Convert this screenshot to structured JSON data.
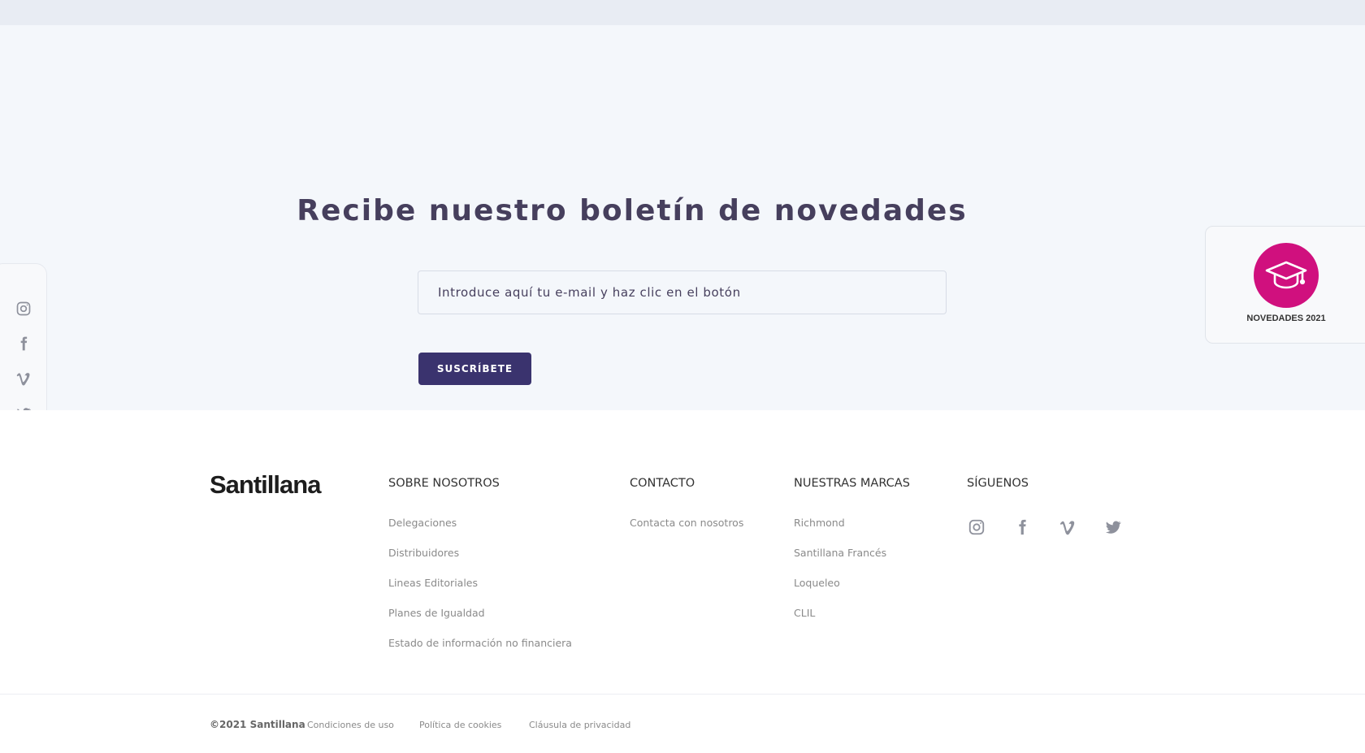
{
  "newsletter": {
    "title": "Recibe nuestro boletín de novedades",
    "email_placeholder": "Introduce aquí tu e-mail y haz clic en el botón",
    "email_value": "",
    "subscribe_label": "SUSCRÍBETE"
  },
  "side_social": {
    "icons": [
      "instagram-icon",
      "facebook-icon",
      "vimeo-icon",
      "twitter-icon"
    ]
  },
  "novedades_badge": {
    "icon": "graduation-cap-icon",
    "label": "NOVEDADES 2021",
    "color": "#d0107e"
  },
  "footer": {
    "logo": "Santillana",
    "columns": [
      {
        "title": "SOBRE NOSOTROS",
        "links": [
          "Delegaciones",
          "Distribuidores",
          "Lineas Editoriales",
          "Planes de Igualdad",
          "Estado de información no financiera"
        ]
      },
      {
        "title": "CONTACTO",
        "links": [
          "Contacta con nosotros"
        ]
      },
      {
        "title": "NUESTRAS MARCAS",
        "links": [
          "Richmond",
          "Santillana Francés",
          "Loqueleo",
          "CLIL"
        ]
      }
    ],
    "follow": {
      "title": "SÍGUENOS",
      "icons": [
        "instagram-icon",
        "facebook-icon",
        "vimeo-icon",
        "twitter-icon"
      ]
    }
  },
  "bottom_bar": {
    "copyright": "©2021 Santillana",
    "links": [
      "Condiciones de uso",
      "Política de cookies",
      "Cláusula de privacidad"
    ]
  },
  "colors": {
    "accent": "#3a336e",
    "title": "#463f5d",
    "badge": "#d0107e",
    "icon_gray": "#8e919c"
  }
}
